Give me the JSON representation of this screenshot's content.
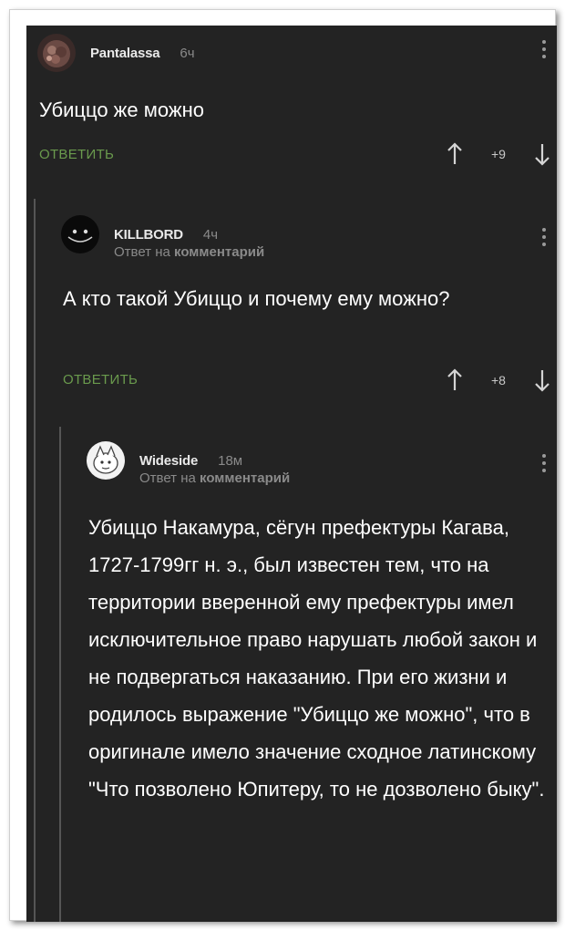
{
  "comments": [
    {
      "author": "Pantalassa",
      "time": "6ч",
      "reply_to_label": "",
      "reply_to_target": "",
      "text": "Убиццо же можно",
      "reply_label": "ОТВЕТИТЬ",
      "score": "+9"
    },
    {
      "author": "KILLBORD",
      "time": "4ч",
      "reply_to_label": "Ответ на",
      "reply_to_target": "комментарий",
      "text": "А кто такой Убиццо и почему ему можно?",
      "reply_label": "ОТВЕТИТЬ",
      "score": "+8"
    },
    {
      "author": "Wideside",
      "time": "18м",
      "reply_to_label": "Ответ на",
      "reply_to_target": "комментарий",
      "text": "Убиццо Накамура, сёгун префектуры Кагава, 1727-1799гг н. э., был известен тем, что на территории вверенной ему префектуры имел исключительное право нарушать любой закон и не подвергаться наказанию. При его жизни и родилось выражение \"Убиццо же можно\", что в оригинале имело значение сходное латинскому \"Что позволено Юпитеру, то не дозволено быку\"."
    }
  ],
  "icons": {
    "more": "more-vertical-icon",
    "upvote": "arrow-up-icon",
    "downvote": "arrow-down-icon"
  },
  "colors": {
    "background": "#232323",
    "reply_button": "#6a9a4d",
    "muted_text": "#8a8a8a"
  }
}
